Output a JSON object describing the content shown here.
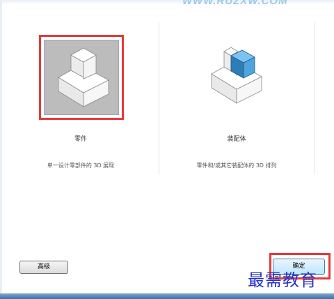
{
  "watermark_top": "WWW.RUZXW.COM",
  "cards": [
    {
      "title": "零件",
      "description": "单一设计零部件的 3D 展现",
      "selected": true
    },
    {
      "title": "装配体",
      "description": "零件和/或其它装配体的 3D 排列",
      "selected": false
    }
  ],
  "buttons": {
    "advanced": "高级",
    "ok": "确定"
  },
  "watermark_bottom": "最需教育",
  "colors": {
    "highlight": "#e5393a",
    "accent_blue": "#3d8fc4",
    "watermark_blue": "#2433c7"
  },
  "icons": {
    "part": "part-model-icon",
    "assembly": "assembly-model-icon"
  }
}
